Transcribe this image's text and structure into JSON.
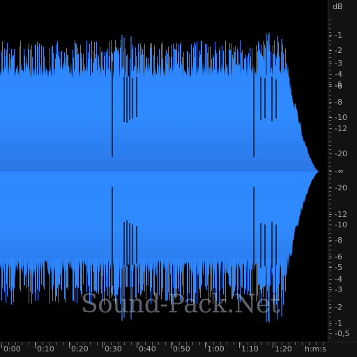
{
  "waveform": {
    "fill_color": "#2e87ff",
    "fill_color_dark": "#2a72e0",
    "background": "#000000"
  },
  "watermark": {
    "text": "Sound-Pack.Net"
  },
  "db_ruler": {
    "unit_label": "dB",
    "labels": [
      "-1",
      "-2",
      "-3",
      "-4",
      "-5",
      "-6",
      "-8",
      "-10",
      "-12",
      "-20",
      "-∞",
      "-20",
      "-12",
      "-10",
      "-8",
      "-6",
      "-5",
      "-4",
      "-3",
      "-2",
      "-1",
      "-0,5"
    ]
  },
  "time_ruler": {
    "labels": [
      "0:00",
      "0:10",
      "0:20",
      "0:30",
      "0:40",
      "0:50",
      "1:00",
      "1:10",
      "1:20"
    ],
    "unit_label": "h:m:s"
  }
}
